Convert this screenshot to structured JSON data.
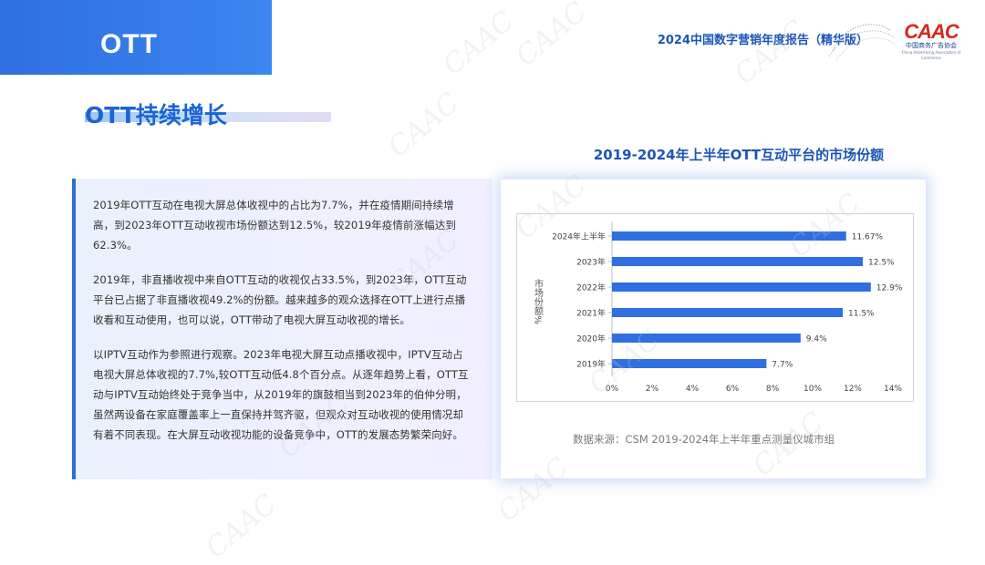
{
  "corner_label": "OTT",
  "report_title": "2024中国数字营销年度报告（精华版）",
  "logo": {
    "main": "CAAC",
    "cn": "中国商务广告协会",
    "en": "China Advertising Association of Commerce"
  },
  "section_title": "OTT持续增长",
  "paragraphs": [
    "2019年OTT互动在电视大屏总体收视中的占比为7.7%，并在疫情期间持续增高，到2023年OTT互动收视市场份额达到12.5%，较2019年疫情前涨幅达到62.3%。",
    "2019年，非直播收视中来自OTT互动的收视仅占33.5%，到2023年，OTT互动平台已占据了非直播收视49.2%的份额。越来越多的观众选择在OTT上进行点播收看和互动使用，也可以说，OTT带动了电视大屏互动收视的增长。",
    "以IPTV互动作为参照进行观察。2023年电视大屏互动点播收视中，IPTV互动占电视大屏总体收视的7.7%,较OTT互动低4.8个百分点。从逐年趋势上看，OTT互动与IPTV互动始终处于竞争当中，从2019年的旗鼓相当到2023年的伯仲分明，虽然两设备在家庭覆盖率上一直保持并驾齐驱，但观众对互动收视的使用情况却有着不同表现。在大屏互动收视功能的设备竞争中，OTT的发展态势繁荣向好。"
  ],
  "source": "数据来源：CSM 2019-2024年上半年重点测量仪城市组",
  "chart_data": {
    "type": "bar",
    "orientation": "horizontal",
    "title": "2019-2024年上半年OTT互动平台的市场份额",
    "ylabel": "市场份额%",
    "xlabel": "",
    "categories": [
      "2024年上半年",
      "2023年",
      "2022年",
      "2021年",
      "2020年",
      "2019年"
    ],
    "values": [
      11.67,
      12.5,
      12.9,
      11.5,
      9.4,
      7.7
    ],
    "data_labels": [
      "11.67%",
      "12.5%",
      "12.9%",
      "11.5%",
      "9.4%",
      "7.7%"
    ],
    "xlim": [
      0,
      14
    ],
    "xticks": [
      0,
      2,
      4,
      6,
      8,
      10,
      12,
      14
    ],
    "xtick_labels": [
      "0%",
      "2%",
      "4%",
      "6%",
      "8%",
      "10%",
      "12%",
      "14%"
    ],
    "bar_color": "#2f6fe0",
    "grid": false,
    "legend": "none"
  },
  "watermark_text": "CAAC"
}
